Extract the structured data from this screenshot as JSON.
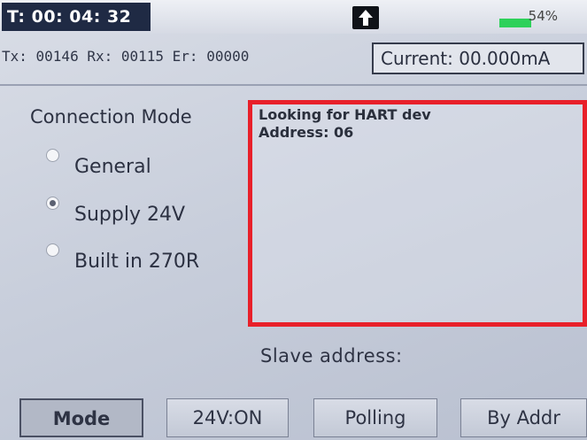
{
  "status_bar": {
    "timer": "T: 00: 04: 32",
    "battery_percent": "54%",
    "battery_level": 0.54
  },
  "counters": {
    "tx_rx_er": "Tx: 00146 Rx: 00115 Er: 00000",
    "current": "Current: 00.000mA"
  },
  "connection_mode": {
    "title": "Connection Mode",
    "options": [
      {
        "label": "General",
        "checked": false
      },
      {
        "label": "Supply 24V",
        "checked": true
      },
      {
        "label": "Built in 270R",
        "checked": false
      }
    ]
  },
  "hart_panel": {
    "line1": "Looking for HART dev",
    "line2": "Address: 06",
    "border_color": "#e8202a"
  },
  "slave_address_label": "Slave address:",
  "softkeys": {
    "mode": "Mode",
    "supply": "24V:ON",
    "polling": "Polling",
    "by_addr": "By Addr"
  },
  "icons": {
    "upload": "up-arrow-icon"
  }
}
